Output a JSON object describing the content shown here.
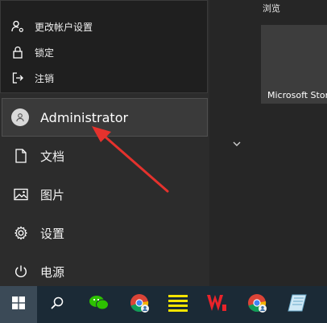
{
  "account_menu": {
    "items": [
      {
        "label": "更改帐户设置",
        "icon": "person-settings-icon"
      },
      {
        "label": "锁定",
        "icon": "lock-icon"
      },
      {
        "label": "注销",
        "icon": "sign-out-icon"
      }
    ]
  },
  "user": {
    "name": "Administrator",
    "icon": "user-avatar-icon"
  },
  "nav": [
    {
      "label": "文档",
      "icon": "document-icon"
    },
    {
      "label": "图片",
      "icon": "picture-icon"
    },
    {
      "label": "设置",
      "icon": "gear-icon"
    },
    {
      "label": "电源",
      "icon": "power-icon"
    }
  ],
  "tiles": {
    "group_label": "浏览",
    "items": [
      {
        "label": "Microsoft Store",
        "icon": "store-icon"
      }
    ]
  },
  "taskbar": {
    "items": [
      {
        "icon": "windows-start-icon"
      },
      {
        "icon": "search-icon"
      },
      {
        "icon": "wechat-icon"
      },
      {
        "icon": "chrome-profile-icon"
      },
      {
        "icon": "notes-app-icon"
      },
      {
        "icon": "wps-office-icon"
      },
      {
        "icon": "chrome-icon"
      },
      {
        "icon": "file-app-icon"
      }
    ]
  },
  "colors": {
    "arrow": "#e5322d",
    "accent": "#3b4a57"
  }
}
